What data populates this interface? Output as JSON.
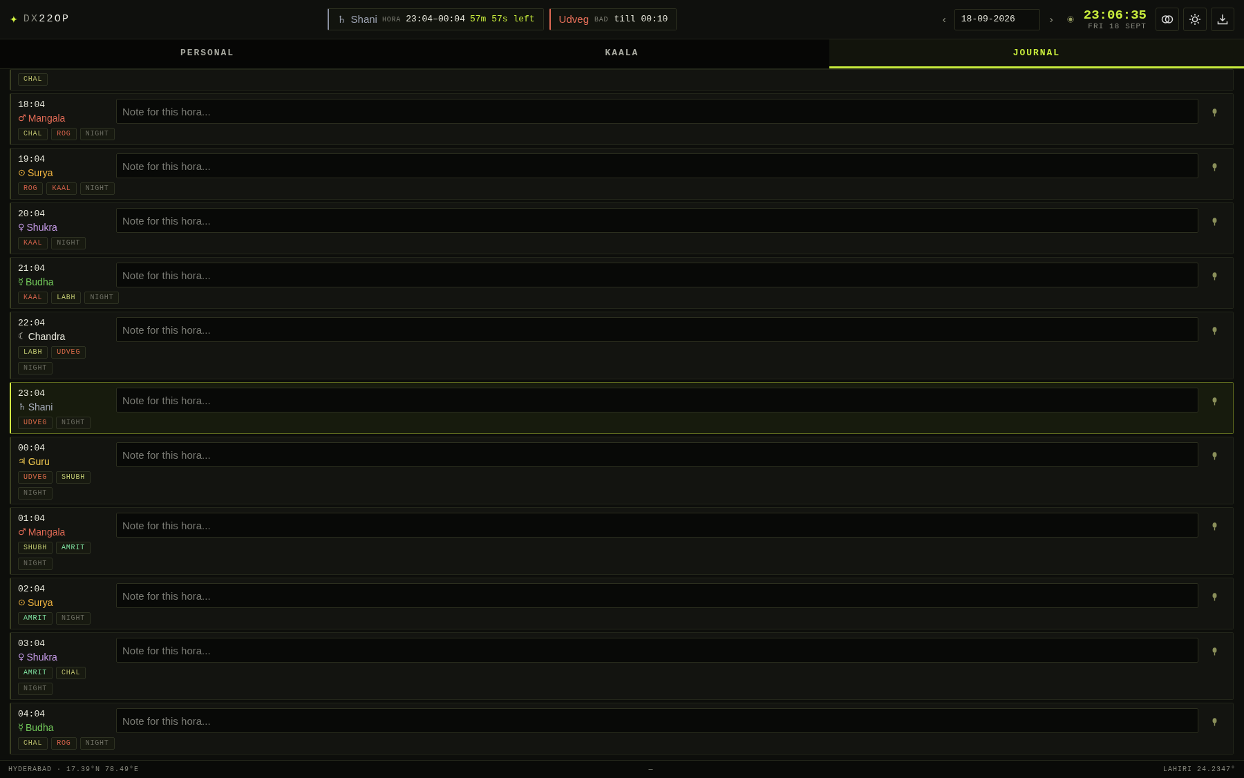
{
  "header": {
    "logo": {
      "mark": "✦",
      "prefix": "DX",
      "name": "22OP"
    },
    "hora_pill": {
      "symbol": "♄",
      "planet": "Shani",
      "label": "HORA",
      "range": "23:04–00:04",
      "remaining": "57m 57s left"
    },
    "alert_pill": {
      "name": "Udveg",
      "label": "BAD",
      "until": "till 00:10"
    },
    "prev": "‹",
    "date": "18-09-2026",
    "next": "›",
    "clock": "23:06:35",
    "day": "FRI 18 SEPT"
  },
  "tabs": [
    {
      "label": "PERSONAL",
      "selected": false
    },
    {
      "label": "KAALA",
      "selected": false
    },
    {
      "label": "JOURNAL",
      "selected": true
    }
  ],
  "rows": [
    {
      "tags": [
        {
          "label": "CHAL",
          "color": "#b5b86a"
        }
      ]
    },
    {
      "time": "18:04",
      "symbol": "♂",
      "planet": "Mangala",
      "color": "#e06a55",
      "selected": false,
      "placeholder": "Note for this hora...",
      "tags": [
        {
          "label": "CHAL",
          "color": "#b5b86a"
        },
        {
          "label": "ROG",
          "color": "#d0604a"
        },
        {
          "label": "NIGHT",
          "color": "#6e6f64"
        }
      ]
    },
    {
      "time": "19:04",
      "symbol": "⊙",
      "planet": "Surya",
      "color": "#f0b440",
      "selected": false,
      "placeholder": "Note for this hora...",
      "tags": [
        {
          "label": "ROG",
          "color": "#d0604a"
        },
        {
          "label": "KAAL",
          "color": "#d0604a"
        },
        {
          "label": "NIGHT",
          "color": "#6e6f64"
        }
      ]
    },
    {
      "time": "20:04",
      "symbol": "♀",
      "planet": "Shukra",
      "color": "#c49ae6",
      "selected": false,
      "placeholder": "Note for this hora...",
      "tags": [
        {
          "label": "KAAL",
          "color": "#d0604a"
        },
        {
          "label": "NIGHT",
          "color": "#6e6f64"
        }
      ]
    },
    {
      "time": "21:04",
      "symbol": "☿",
      "planet": "Budha",
      "color": "#72c85a",
      "selected": false,
      "placeholder": "Note for this hora...",
      "tags": [
        {
          "label": "KAAL",
          "color": "#d0604a"
        },
        {
          "label": "LABH",
          "color": "#bfc870"
        },
        {
          "label": "NIGHT",
          "color": "#6e6f64"
        }
      ]
    },
    {
      "time": "22:04",
      "symbol": "☾",
      "planet": "Chandra",
      "color": "#e4e4d8",
      "selected": false,
      "placeholder": "Note for this hora...",
      "tags": [
        {
          "label": "LABH",
          "color": "#bfc870"
        },
        {
          "label": "UDVEG",
          "color": "#d86a48"
        },
        {
          "label": "NIGHT",
          "color": "#6e6f64"
        }
      ]
    },
    {
      "time": "23:04",
      "symbol": "♄",
      "planet": "Shani",
      "color": "#a4aab8",
      "selected": true,
      "placeholder": "Note for this hora...",
      "tags": [
        {
          "label": "UDVEG",
          "color": "#d86a48"
        },
        {
          "label": "NIGHT",
          "color": "#6e6f64"
        }
      ]
    },
    {
      "time": "00:04",
      "symbol": "♃",
      "planet": "Guru",
      "color": "#f0c850",
      "selected": false,
      "placeholder": "Note for this hora...",
      "tags": [
        {
          "label": "UDVEG",
          "color": "#d86a48"
        },
        {
          "label": "SHUBH",
          "color": "#bfc870"
        },
        {
          "label": "NIGHT",
          "color": "#6e6f64"
        }
      ]
    },
    {
      "time": "01:04",
      "symbol": "♂",
      "planet": "Mangala",
      "color": "#e06a55",
      "selected": false,
      "placeholder": "Note for this hora...",
      "tags": [
        {
          "label": "SHUBH",
          "color": "#bfc870"
        },
        {
          "label": "AMRIT",
          "color": "#7ee0a0"
        },
        {
          "label": "NIGHT",
          "color": "#6e6f64"
        }
      ]
    },
    {
      "time": "02:04",
      "symbol": "⊙",
      "planet": "Surya",
      "color": "#f0b440",
      "selected": false,
      "placeholder": "Note for this hora...",
      "tags": [
        {
          "label": "AMRIT",
          "color": "#7ee0a0"
        },
        {
          "label": "NIGHT",
          "color": "#6e6f64"
        }
      ]
    },
    {
      "time": "03:04",
      "symbol": "♀",
      "planet": "Shukra",
      "color": "#c49ae6",
      "selected": false,
      "placeholder": "Note for this hora...",
      "tags": [
        {
          "label": "AMRIT",
          "color": "#7ee0a0"
        },
        {
          "label": "CHAL",
          "color": "#b5b86a"
        },
        {
          "label": "NIGHT",
          "color": "#6e6f64"
        }
      ]
    },
    {
      "time": "04:04",
      "symbol": "☿",
      "planet": "Budha",
      "color": "#72c85a",
      "selected": false,
      "placeholder": "Note for this hora...",
      "tags": [
        {
          "label": "CHAL",
          "color": "#b5b86a"
        },
        {
          "label": "ROG",
          "color": "#d0604a"
        },
        {
          "label": "NIGHT",
          "color": "#6e6f64"
        }
      ]
    }
  ],
  "status_bar": {
    "location": "HYDERABAD · 17.39°N 78.49°E",
    "center": "—",
    "ayanamsa": "LAHIRI 24.2347°"
  }
}
